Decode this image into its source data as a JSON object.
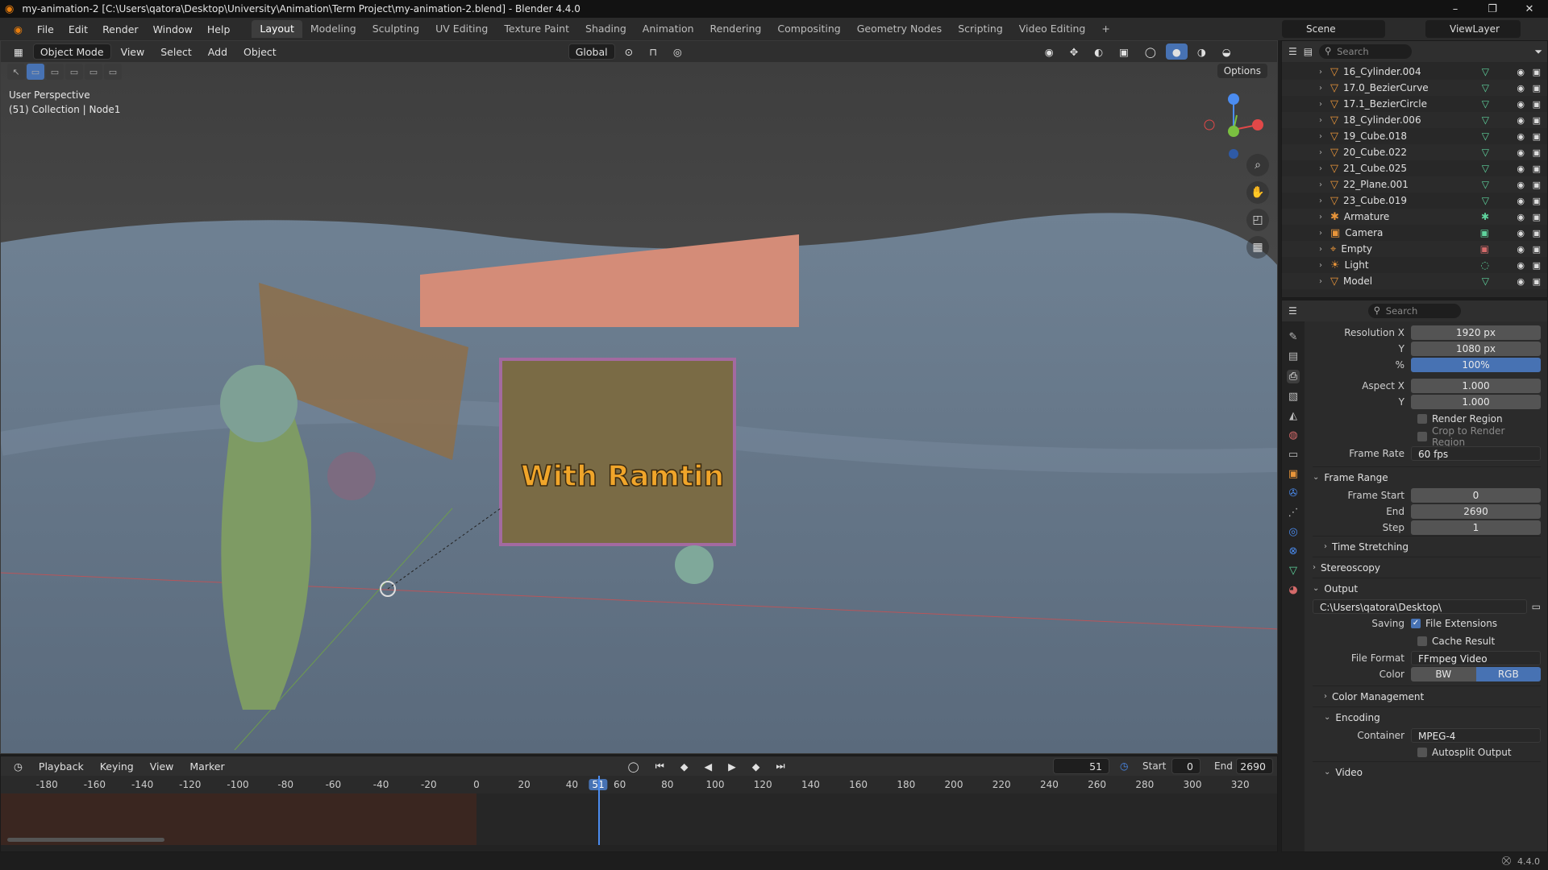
{
  "window": {
    "title": "my-animation-2 [C:\\Users\\qatora\\Desktop\\University\\Animation\\Term Project\\my-animation-2.blend] - Blender 4.4.0"
  },
  "menu": [
    "File",
    "Edit",
    "Render",
    "Window",
    "Help"
  ],
  "workspaces": [
    {
      "label": "Layout",
      "active": true
    },
    {
      "label": "Modeling"
    },
    {
      "label": "Sculpting"
    },
    {
      "label": "UV Editing"
    },
    {
      "label": "Texture Paint"
    },
    {
      "label": "Shading"
    },
    {
      "label": "Animation"
    },
    {
      "label": "Rendering"
    },
    {
      "label": "Compositing"
    },
    {
      "label": "Geometry Nodes"
    },
    {
      "label": "Scripting"
    },
    {
      "label": "Video Editing"
    }
  ],
  "scene": {
    "name": "Scene",
    "view_layer": "ViewLayer"
  },
  "viewport": {
    "mode": "Object Mode",
    "menus": [
      "View",
      "Select",
      "Add",
      "Object"
    ],
    "transform": "Global",
    "options": "Options",
    "perspective": "User Perspective",
    "collection_info": "(51) Collection | Node1",
    "sign_text": "With Ramtin"
  },
  "outliner": {
    "search_placeholder": "Search",
    "rows": [
      "16_Cylinder.004",
      "17.0_BezierCurve",
      "17.1_BezierCircle",
      "18_Cylinder.006",
      "19_Cube.018",
      "20_Cube.022",
      "21_Cube.025",
      "22_Plane.001",
      "23_Cube.019",
      "Armature",
      "Camera",
      "Empty",
      "Light",
      "Model"
    ]
  },
  "properties": {
    "search_placeholder": "Search",
    "resolution_x_label": "Resolution X",
    "resolution_x": "1920 px",
    "y_label": "Y",
    "resolution_y": "1080 px",
    "percent_label": "%",
    "percent": "100%",
    "aspect_x_label": "Aspect X",
    "aspect_x": "1.000",
    "aspect_y": "1.000",
    "render_region": "Render Region",
    "crop_region": "Crop to Render Region",
    "frame_rate_label": "Frame Rate",
    "frame_rate": "60 fps",
    "frame_range_title": "Frame Range",
    "frame_start_label": "Frame Start",
    "frame_start": "0",
    "end_label": "End",
    "frame_end": "2690",
    "step_label": "Step",
    "frame_step": "1",
    "time_stretching": "Time Stretching",
    "stereoscopy": "Stereoscopy",
    "output_title": "Output",
    "output_path": "C:\\Users\\qatora\\Desktop\\",
    "saving_label": "Saving",
    "file_extensions": "File Extensions",
    "cache_result": "Cache Result",
    "file_format_label": "File Format",
    "file_format": "FFmpeg Video",
    "color_label": "Color",
    "color_bw": "BW",
    "color_rgb": "RGB",
    "color_management": "Color Management",
    "encoding": "Encoding",
    "container_label": "Container",
    "container": "MPEG-4",
    "autosplit": "Autosplit Output",
    "video": "Video"
  },
  "timeline": {
    "menus": [
      "Playback",
      "Keying",
      "View",
      "Marker"
    ],
    "current_frame": "51",
    "start_label": "Start",
    "start": "0",
    "end_label": "End",
    "end": "2690",
    "ticks": [
      "-180",
      "-160",
      "-140",
      "-120",
      "-100",
      "-80",
      "-60",
      "-40",
      "-20",
      "0",
      "20",
      "40",
      "51",
      "60",
      "80",
      "100",
      "120",
      "140",
      "160",
      "180",
      "200",
      "220",
      "240",
      "260",
      "280",
      "300",
      "320"
    ]
  },
  "status": {
    "version": "4.4.0"
  }
}
